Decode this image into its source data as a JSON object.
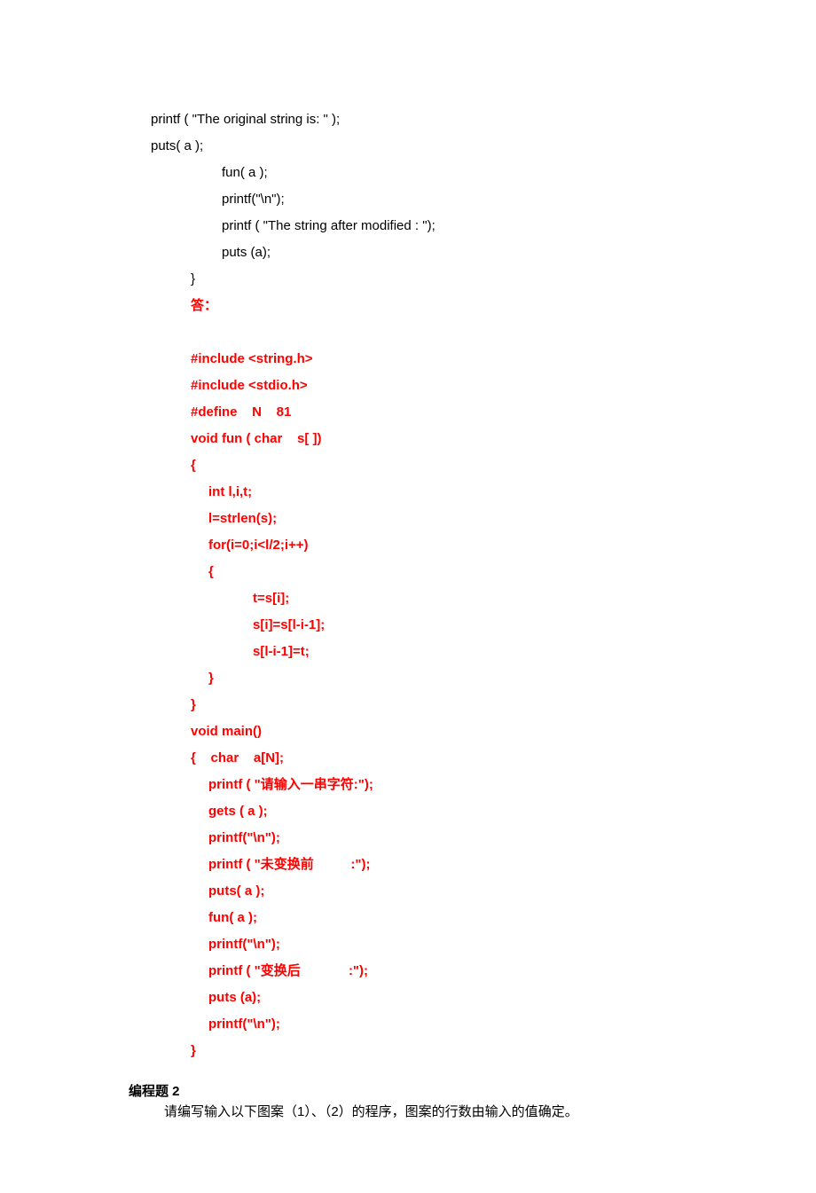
{
  "code_black": {
    "l1": "printf ( \"The original string is: \" );",
    "l2": "puts( a );",
    "l3": "fun( a );",
    "l4": "printf(\"\\n\");",
    "l5": "printf ( \"The string after modified : \");",
    "l6": "puts (a);",
    "l7": "}"
  },
  "answer_label": "答：",
  "code_red": {
    "r1": "#include <string.h>",
    "r2": "#include <stdio.h>",
    "r3": "#define    N    81",
    "r4": "void fun ( char    s[ ])",
    "r5": "{",
    "r6": "int l,i,t;",
    "r7": "l=strlen(s);",
    "r8": "for(i=0;i<l/2;i++)",
    "r9": "{",
    "r10": "t=s[i];",
    "r11": "s[i]=s[l-i-1];",
    "r12": "s[l-i-1]=t;",
    "r13": "}",
    "r14": "}",
    "r15": "void main()",
    "r16": "{    char    a[N];",
    "r17": "printf ( \"请输入一串字符:\");",
    "r18": "gets ( a );",
    "r19": "printf(\"\\n\");",
    "r20": "printf ( \"未变换前          :\");",
    "r21": "puts( a );",
    "r22": "fun( a );",
    "r23": "printf(\"\\n\");",
    "r24": "printf ( \"变换后             :\");",
    "r25": "puts (a);",
    "r26": "printf(\"\\n\");",
    "r27": "}"
  },
  "section2_title": "编程题 2",
  "section2_question": "请编写输入以下图案（1）、（2）的程序，图案的行数由输入的值确定。"
}
